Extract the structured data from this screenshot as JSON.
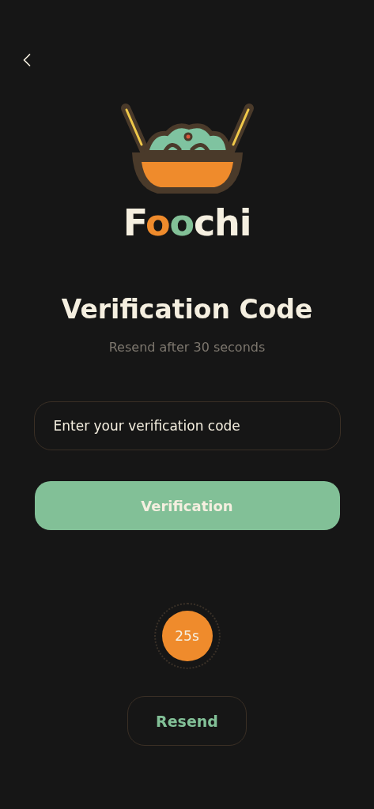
{
  "logo": {
    "parts": [
      {
        "text": "F",
        "color": "#f5efe0"
      },
      {
        "text": "o",
        "color": "#ef8b2c"
      },
      {
        "text": "o",
        "color": "#82c097"
      },
      {
        "text": "chi",
        "color": "#f5efe0"
      }
    ]
  },
  "title": "Verification Code",
  "subtitle": "Resend after 30 seconds",
  "code_field": {
    "placeholder": "Enter your verification code"
  },
  "verify_button": {
    "label": "Verification"
  },
  "countdown": {
    "text": "25s"
  },
  "resend_button": {
    "label": "Resend"
  }
}
